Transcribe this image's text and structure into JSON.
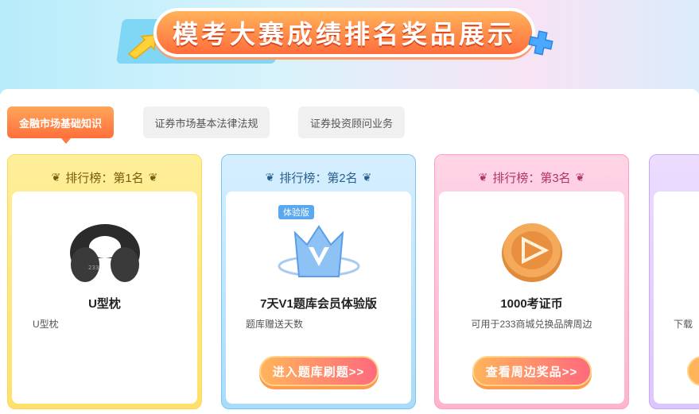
{
  "banner": {
    "title": "模考大赛成绩排名奖品展示"
  },
  "tabs": [
    {
      "label": "金融市场基础知识",
      "active": true
    },
    {
      "label": "证券市场基本法律法规",
      "active": false
    },
    {
      "label": "证券投资顾问业务",
      "active": false
    }
  ],
  "cards": [
    {
      "rank": "排行榜：第1名",
      "prize_name": "U型枕",
      "desc": "U型枕",
      "image_icon": "u-pillow-icon",
      "theme_color": "#ffe06a"
    },
    {
      "rank": "排行榜：第2名",
      "badge": "体验版",
      "prize_name": "7天V1题库会员体验版",
      "desc": "题库赠送天数",
      "button": "进入题库刷题>>",
      "image_icon": "vip-crown-icon",
      "theme_color": "#a9dcfa"
    },
    {
      "rank": "排行榜：第3名",
      "prize_name": "1000考证币",
      "desc": "可用于233商城兑换品牌周边",
      "button": "查看周边奖品>>",
      "image_icon": "coin-icon",
      "theme_color": "#ffb3cf"
    },
    {
      "desc_partial": "下载",
      "theme_color": "#dcc6ff"
    }
  ],
  "colors": {
    "accent": "#ff6f3a",
    "button_gradient_start": "#ffb45a",
    "button_gradient_end": "#ff6a7d"
  }
}
